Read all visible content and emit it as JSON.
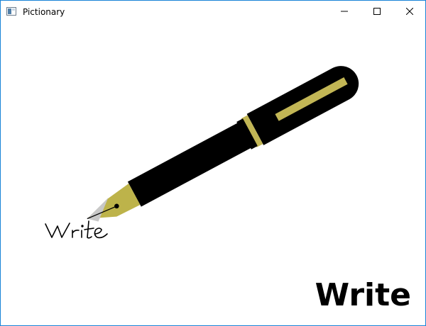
{
  "window": {
    "title": "Pictionary"
  },
  "controls": {
    "minimize": "minimize-icon",
    "maximize": "maximize-icon",
    "close": "close-icon"
  },
  "drawing": {
    "subject": "fountain pen",
    "handwritten_word": "Write",
    "colors": {
      "pen_body": "#000000",
      "pen_accent": "#c2b655",
      "nib_gold": "#bdb34a",
      "nib_silver": "#c8c8c8"
    }
  },
  "answer": {
    "word": "Write"
  }
}
